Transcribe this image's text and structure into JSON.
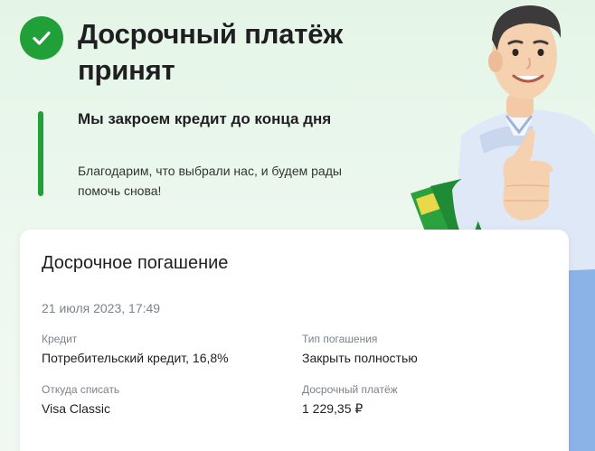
{
  "header": {
    "title": "Досрочный платёж принят"
  },
  "message": {
    "title": "Мы закроем кредит до конца дня",
    "text": "Благодарим, что выбрали нас, и будем рады помочь снова!"
  },
  "card": {
    "title": "Досрочное погашение",
    "datetime": "21 июля 2023, 17:49",
    "fields": [
      {
        "label": "Кредит",
        "value": "Потребительский кредит, 16,8%"
      },
      {
        "label": "Тип погашения",
        "value": "Закрыть полностью"
      },
      {
        "label": "Откуда списать",
        "value": "Visa Classic"
      },
      {
        "label": "Досрочный платёж",
        "value": "1 229,35 ₽"
      }
    ]
  },
  "icons": {
    "status": "check-icon",
    "illustration": "man-thumbs-up-illustration"
  },
  "colors": {
    "accent": "#21a038",
    "background": "#eaf6ec",
    "card": "#ffffff",
    "muted_text": "#7d838a"
  }
}
